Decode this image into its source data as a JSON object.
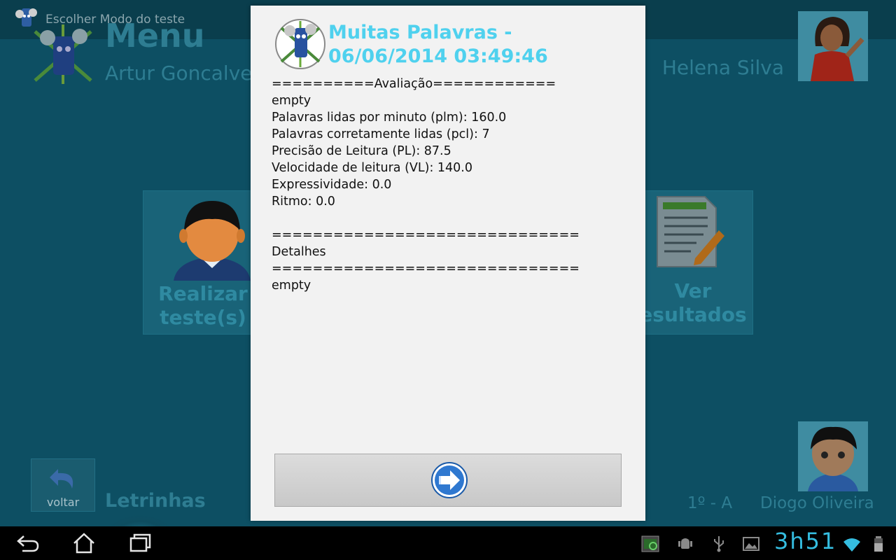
{
  "app": {
    "window_title": "Escolher Modo do teste",
    "menu_heading": "Menu",
    "student_name": "Artur Goncalves",
    "teacher_name": "Helena Silva",
    "tiles": {
      "left_label_1": "Realizar",
      "left_label_2": "teste(s)",
      "right_label_1": "Ver",
      "right_label_2": "esultados"
    },
    "back_label": "voltar",
    "footer_app_name": "Letrinhas",
    "class_label": "1º - A",
    "kid_name": "Diogo Oliveira"
  },
  "dialog": {
    "title": "Muitas Palavras - 06/06/2014 03:49:46",
    "lines": [
      "==========Avaliação============",
      "empty",
      "Palavras lidas por minuto (plm): 160.0",
      "Palavras corretamente lidas (pcl): 7",
      "Precisão de Leitura (PL): 87.5",
      "Velocidade de leitura (VL): 140.0",
      "Expressividade: 0.0",
      "Ritmo: 0.0",
      "",
      "==============================",
      "Detalhes",
      "==============================",
      "empty"
    ],
    "confirm_icon": "arrow-right-icon"
  },
  "system_bar": {
    "clock": "3h51",
    "accent_color": "#35bde0"
  },
  "colors": {
    "dialog_title": "#4fd1ee",
    "app_background": "#0d4f63"
  }
}
